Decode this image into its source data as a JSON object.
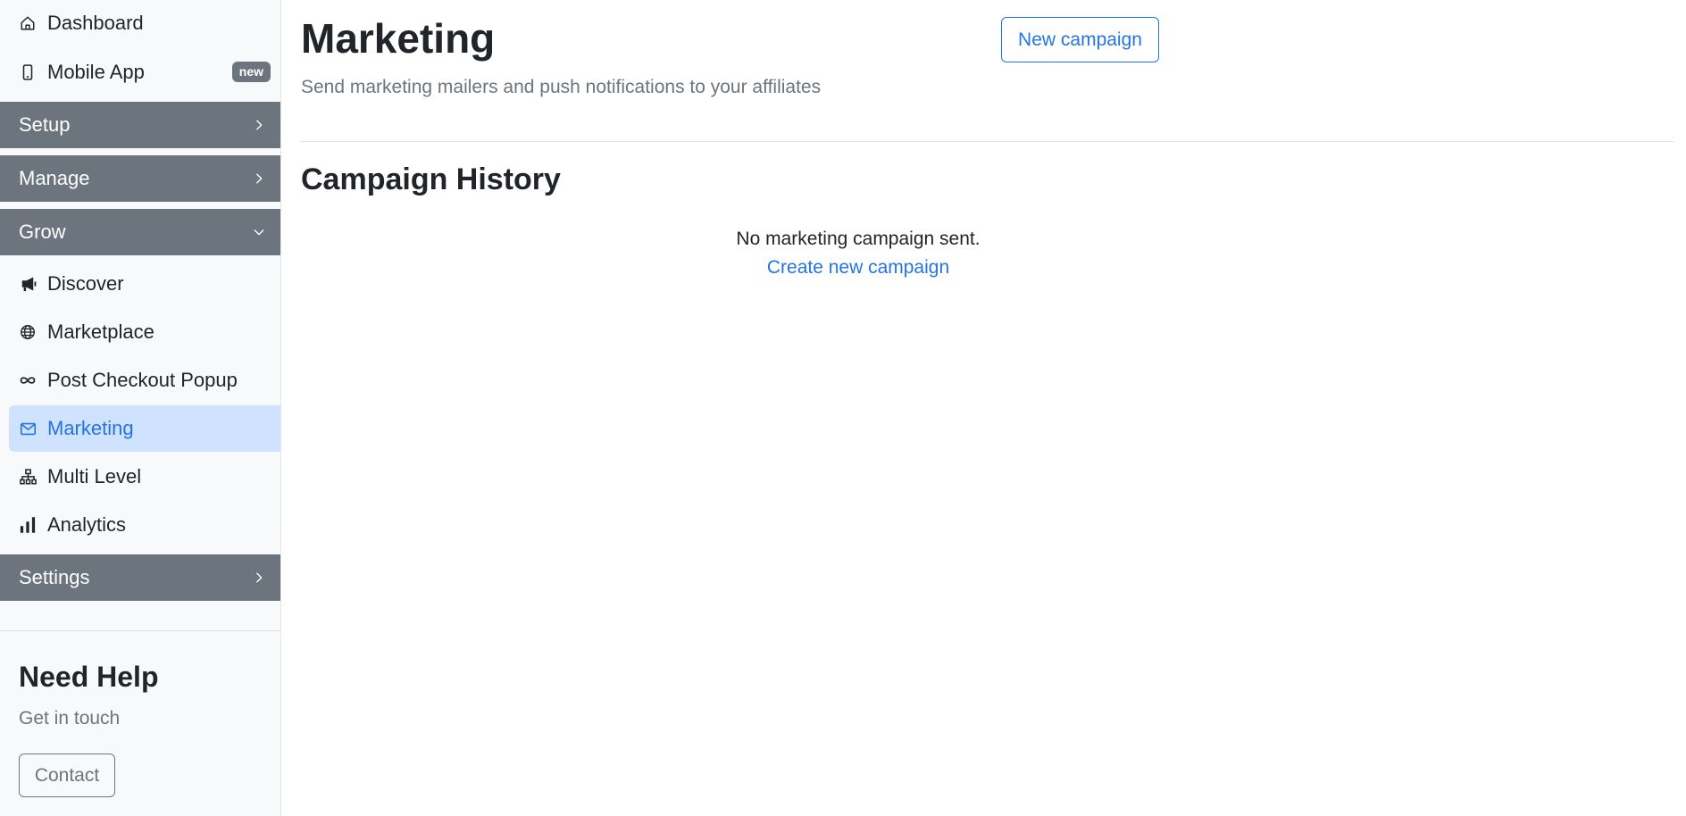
{
  "sidebar": {
    "top_items": [
      {
        "label": "Dashboard",
        "icon": "house-icon"
      },
      {
        "label": "Mobile App",
        "icon": "mobile-phone-icon",
        "badge": "new"
      }
    ],
    "sections": {
      "setup": {
        "label": "Setup",
        "state": "collapsed"
      },
      "manage": {
        "label": "Manage",
        "state": "collapsed"
      },
      "grow": {
        "label": "Grow",
        "state": "expanded"
      },
      "settings": {
        "label": "Settings",
        "state": "collapsed"
      }
    },
    "grow_items": [
      {
        "label": "Discover",
        "icon": "megaphone-icon"
      },
      {
        "label": "Marketplace",
        "icon": "globe-icon"
      },
      {
        "label": "Post Checkout Popup",
        "icon": "infinity-icon"
      },
      {
        "label": "Marketing",
        "icon": "envelope-icon",
        "active": true
      },
      {
        "label": "Multi Level",
        "icon": "hierarchy-icon"
      },
      {
        "label": "Analytics",
        "icon": "bar-chart-icon"
      }
    ],
    "help": {
      "title": "Need Help",
      "subtitle": "Get in touch",
      "contact_label": "Contact"
    }
  },
  "main": {
    "title": "Marketing",
    "subtitle": "Send marketing mailers and push notifications to your affiliates",
    "new_campaign_label": "New campaign",
    "history": {
      "title": "Campaign History",
      "empty_text": "No marketing campaign sent.",
      "create_link": "Create new campaign"
    }
  },
  "colors": {
    "accent": "#2474e5",
    "active_bg": "#cfe2ff",
    "section_header_bg": "#6c757d",
    "sidebar_bg": "#f8f9fa"
  }
}
